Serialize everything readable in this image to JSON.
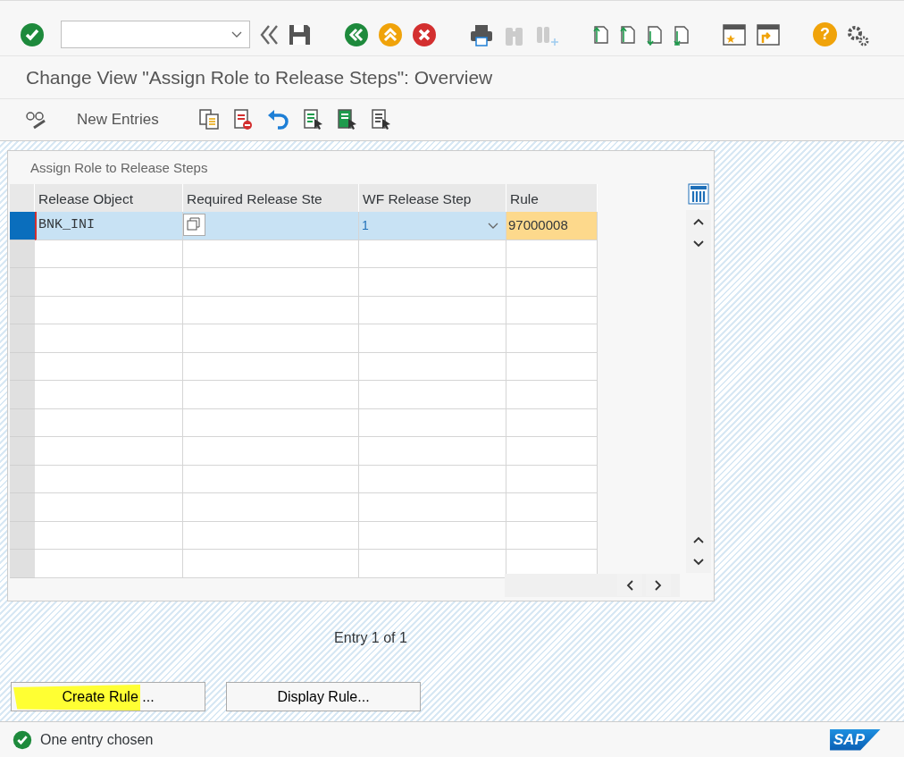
{
  "title": "Change View \"Assign Role to Release Steps\": Overview",
  "app_toolbar": {
    "new_entries": "New Entries"
  },
  "table": {
    "title": "Assign Role to Release Steps",
    "columns": [
      "Release Object",
      "Required Release Ste",
      "WF Release Step",
      "Rule"
    ],
    "rows": [
      {
        "selected": true,
        "release_object": "BNK_INI",
        "wf_release_step": "1",
        "rule": "97000008"
      }
    ]
  },
  "entry_count": "Entry 1 of 1",
  "buttons": [
    {
      "label": "Create Rule ...",
      "highlighted": true
    },
    {
      "label": "Display Rule...",
      "highlighted": false
    }
  ],
  "help_glyph": "?",
  "status_bar": {
    "message": "One entry chosen"
  },
  "logo": "SAP"
}
